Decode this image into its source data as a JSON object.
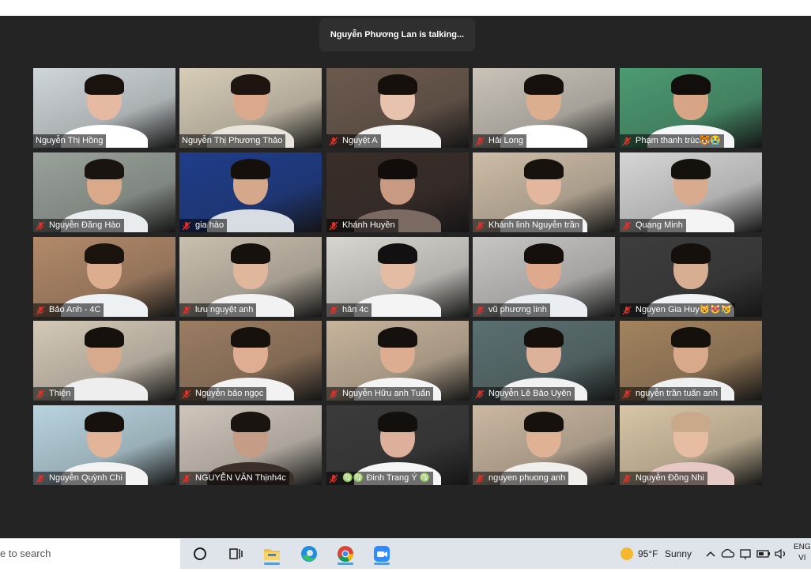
{
  "meeting": {
    "talking_text": "Nguyễn Phương Lan is talking...",
    "participants": [
      {
        "name": "Nguyễn Thị Hồng",
        "muted": false,
        "bg": "#cfd6d9",
        "skin": "#e6b9a3",
        "shirt": "#ffffff",
        "hair": "#1a120d"
      },
      {
        "name": "Nguyễn Thị Phương Thảo",
        "muted": false,
        "bg": "#d7cdb8",
        "skin": "#d9a88d",
        "shirt": "#e9e4dc",
        "hair": "#1e1410"
      },
      {
        "name": "Nguyệt A",
        "muted": true,
        "bg": "#6c5a4e",
        "skin": "#e7c2ad",
        "shirt": "#f2f2f2",
        "hair": "#15100c"
      },
      {
        "name": "Hải Long",
        "muted": true,
        "bg": "#c9c3b8",
        "skin": "#dcae90",
        "shirt": "#ffffff",
        "hair": "#17110d"
      },
      {
        "name": "Phạm thanh trúc🐯😭",
        "muted": true,
        "bg": "#4c9a72",
        "skin": "#d6a586",
        "shirt": "#f4f6f8",
        "hair": "#120e0b"
      },
      {
        "name": "Nguyễn Đăng Hào",
        "muted": true,
        "bg": "#9aa29a",
        "skin": "#d9a98a",
        "shirt": "#e8ecef",
        "hair": "#1a1410"
      },
      {
        "name": "gia hào",
        "muted": true,
        "bg": "#1f3d8a",
        "skin": "#d5a88c",
        "shirt": "#d8dde4",
        "hair": "#15100c"
      },
      {
        "name": "Khánh Huyền",
        "muted": true,
        "bg": "#3a2e2a",
        "skin": "#c99a82",
        "shirt": "#7a6a62",
        "hair": "#120d0a"
      },
      {
        "name": "Khánh linh Nguyễn trần",
        "muted": true,
        "bg": "#cdbda7",
        "skin": "#e2b79d",
        "shirt": "#f5f5f5",
        "hair": "#18120e"
      },
      {
        "name": "Quang Minh",
        "muted": true,
        "bg": "#d6d6d6",
        "skin": "#d8ab8f",
        "shirt": "#f4f4f4",
        "hair": "#15110d"
      },
      {
        "name": "Bảo Anh - 4C",
        "muted": true,
        "bg": "#b28a6a",
        "skin": "#dcad8f",
        "shirt": "#eef1f4",
        "hair": "#1a130e"
      },
      {
        "name": "lưu nguyệt anh",
        "muted": true,
        "bg": "#c8bfae",
        "skin": "#e0b69c",
        "shirt": "#f2f2f2",
        "hair": "#16110d"
      },
      {
        "name": "hân 4c",
        "muted": true,
        "bg": "#d8d6d0",
        "skin": "#e4bba3",
        "shirt": "#f4f4f4",
        "hair": "#121010"
      },
      {
        "name": "vũ phương linh",
        "muted": true,
        "bg": "#c7c6c4",
        "skin": "#dfa98e",
        "shirt": "#eaeef2",
        "hair": "#15100c"
      },
      {
        "name": "Nguyen Gia Huy😾😻😿",
        "muted": true,
        "bg": "#3d3d3d",
        "skin": "#d8ae93",
        "shirt": "#f0f3f6",
        "hair": "#15100c"
      },
      {
        "name": "Thiện",
        "muted": true,
        "bg": "#d3c9b8",
        "skin": "#d7aa8e",
        "shirt": "#eeeeee",
        "hair": "#16110d"
      },
      {
        "name": "Nguyễn bảo ngọc",
        "muted": true,
        "bg": "#9b7d62",
        "skin": "#dfae92",
        "shirt": "#f2f2f2",
        "hair": "#17110d"
      },
      {
        "name": "Nguyễn Hữu anh Tuấn",
        "muted": true,
        "bg": "#c7b49c",
        "skin": "#dcad91",
        "shirt": "#f4f4f4",
        "hair": "#15110e"
      },
      {
        "name": "Nguyễn Lê Bảo Uyên",
        "muted": true,
        "bg": "#5b6f70",
        "skin": "#deb29a",
        "shirt": "#f1f1f1",
        "hair": "#15100c"
      },
      {
        "name": "nguyễn trần tuấn anh",
        "muted": true,
        "bg": "#a2835f",
        "skin": "#d8a98b",
        "shirt": "#eef0f2",
        "hair": "#14100c"
      },
      {
        "name": "Nguyễn Quỳnh Chi",
        "muted": true,
        "bg": "#b9d4df",
        "skin": "#e2b59a",
        "shirt": "#f3f3f3",
        "hair": "#16110d"
      },
      {
        "name": "NGUYỄN VĂN Thịnh4c",
        "muted": true,
        "bg": "#cfc6bb",
        "skin": "#c59c86",
        "shirt": "#3b2f2a",
        "hair": "#1a1410"
      },
      {
        "name": "♍♍ Đinh Trang Ý ♍",
        "muted": true,
        "bg": "#3b3b3b",
        "skin": "#dcb09a",
        "shirt": "#f5f5f5",
        "hair": "#130f0c"
      },
      {
        "name": "nguyen phuong anh",
        "muted": true,
        "bg": "#cbb8a2",
        "skin": "#dfb296",
        "shirt": "#f1efec",
        "hair": "#16110d"
      },
      {
        "name": "Nguyễn Đồng Nhi",
        "muted": true,
        "bg": "#d8c6a6",
        "skin": "#e6bca3",
        "shirt": "#e6c9c5",
        "hair": "#c9a98a"
      }
    ]
  },
  "taskbar": {
    "search_placeholder": "e to search",
    "weather_temp": "95°F",
    "weather_text": "Sunny",
    "lang_1": "ENG",
    "lang_2": "VI"
  }
}
